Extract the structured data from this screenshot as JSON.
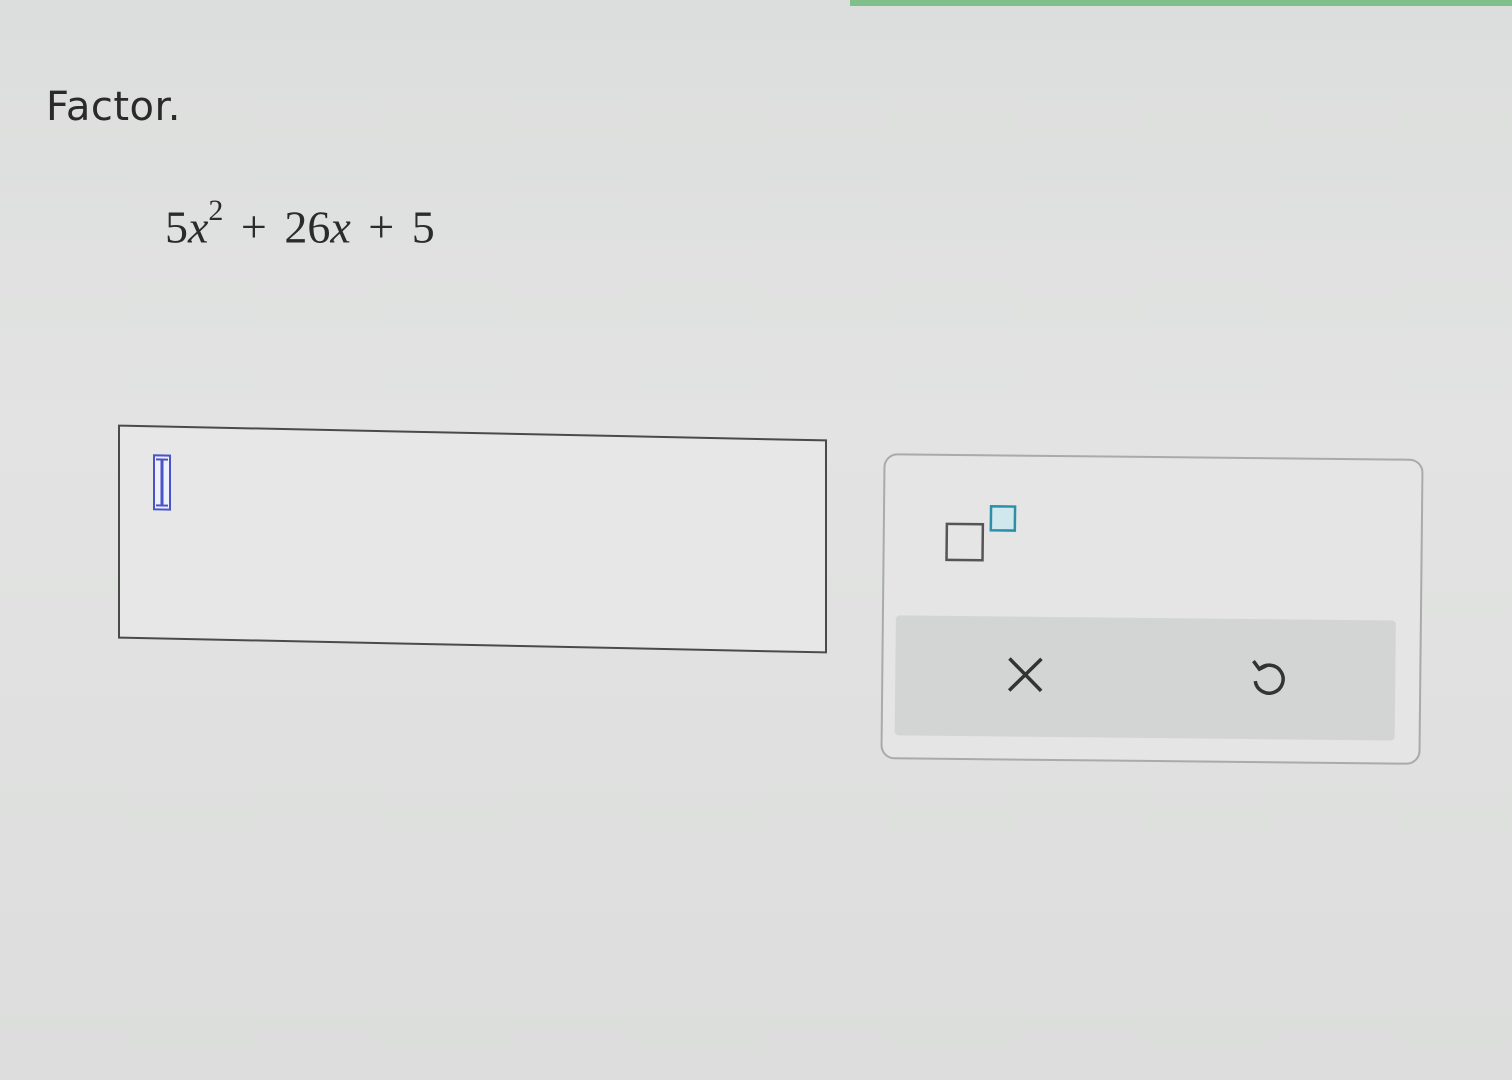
{
  "question": {
    "instruction": "Factor.",
    "expression": {
      "term1_coef": "5",
      "term1_var": "x",
      "term1_exp": "2",
      "op1": "+",
      "term2_coef": "26",
      "term2_var": "x",
      "op2": "+",
      "term3": "5"
    }
  },
  "answer": {
    "value": ""
  },
  "toolbar": {
    "exponent_icon": "superscript-template-icon",
    "clear_icon": "close-icon",
    "undo_icon": "undo-icon"
  },
  "colors": {
    "accent": "#7fc08a",
    "icon_teal": "#2a8fa8",
    "cursor_blue": "#4b53c9"
  }
}
